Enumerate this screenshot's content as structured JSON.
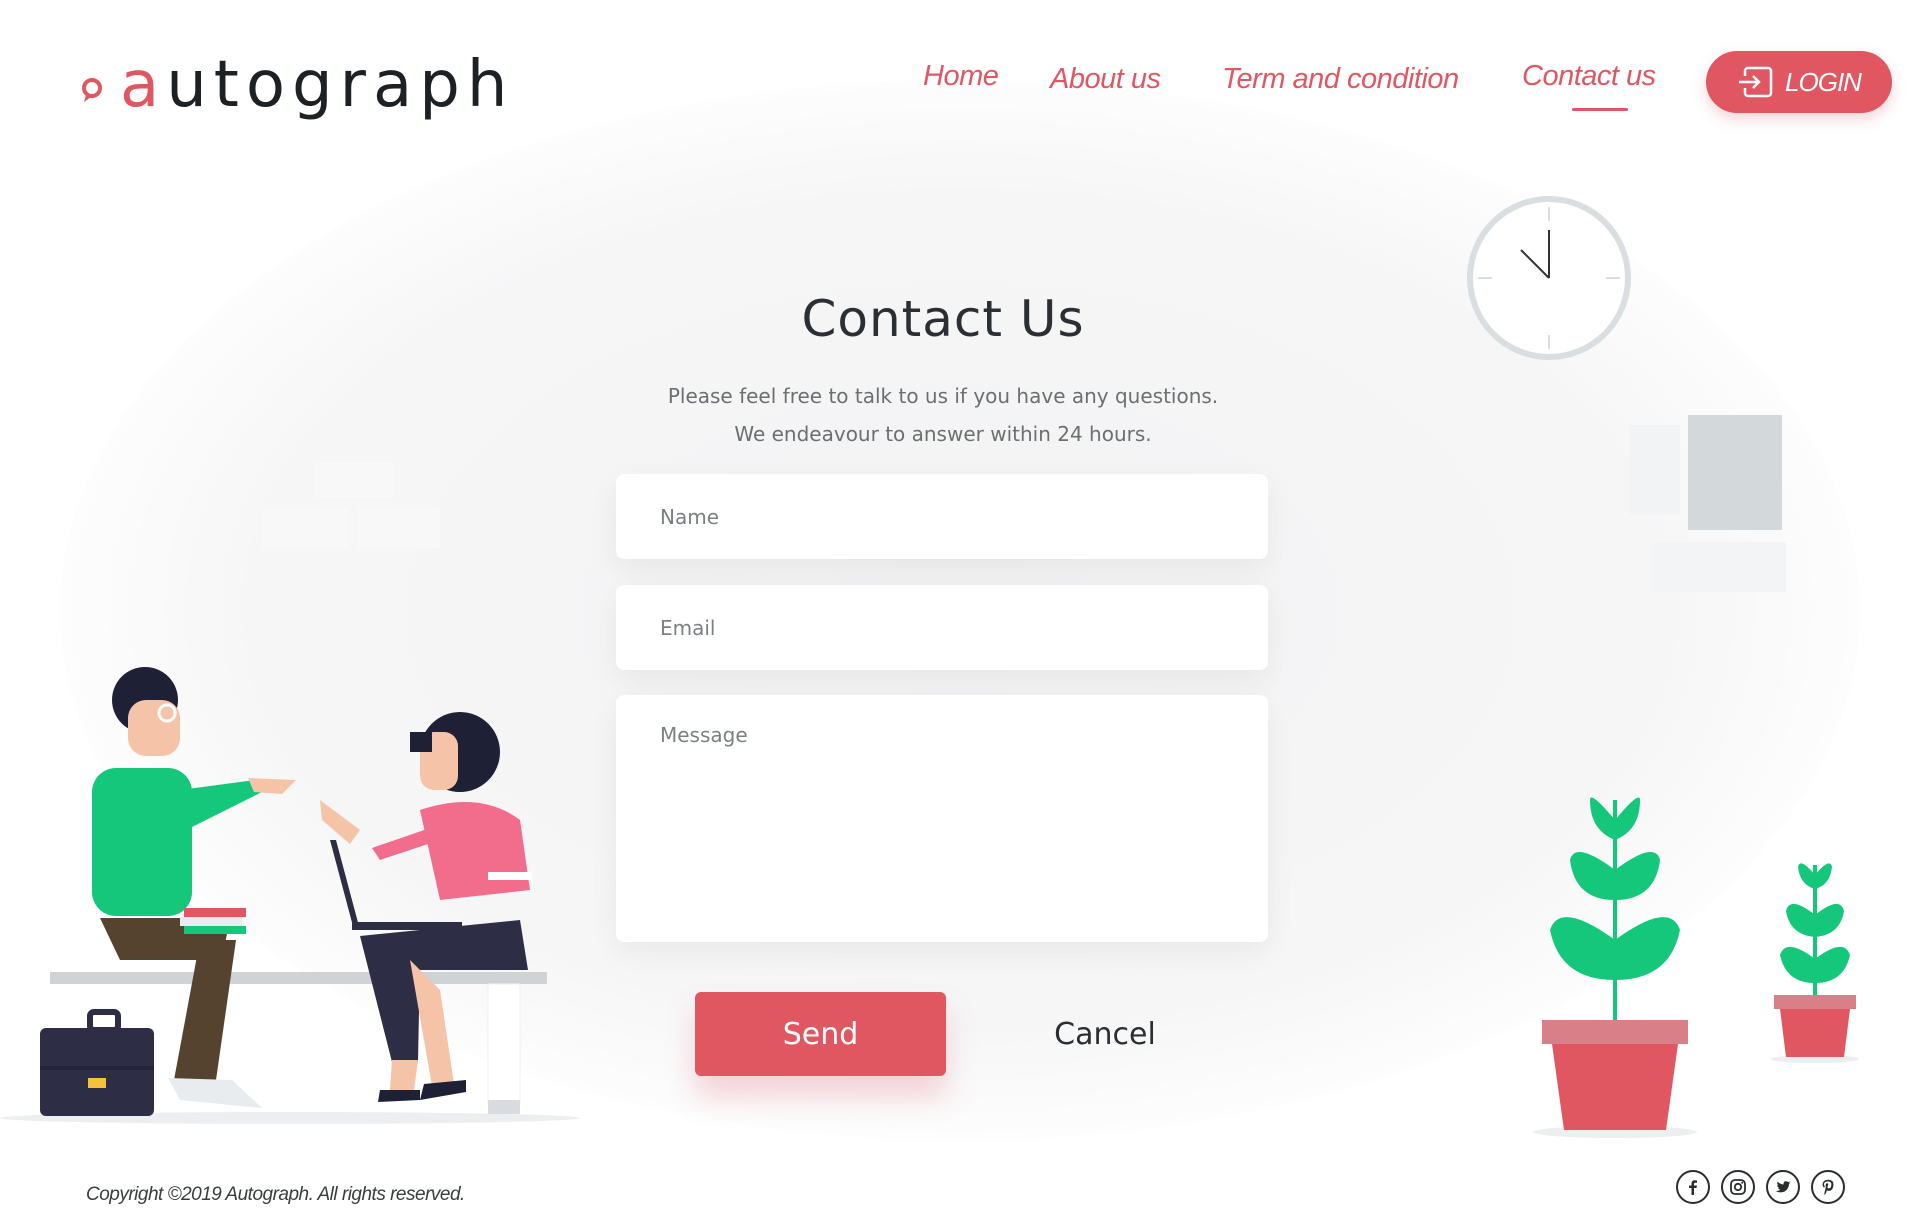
{
  "brand": {
    "name_accent": "a",
    "name_rest": "utograph",
    "accent_color": "#e05762"
  },
  "nav": {
    "items": [
      {
        "label": "Home"
      },
      {
        "label": "About us"
      },
      {
        "label": "Term and condition"
      },
      {
        "label": "Contact us",
        "active": true
      }
    ],
    "login_label": "LOGIN"
  },
  "main": {
    "title": "Contact Us",
    "subtitle_line1": "Please feel free to talk to us if you have any questions.",
    "subtitle_line2": "We endeavour to answer within 24 hours."
  },
  "form": {
    "name_placeholder": "Name",
    "email_placeholder": "Email",
    "message_placeholder": "Message",
    "send_label": "Send",
    "cancel_label": "Cancel"
  },
  "footer": {
    "copyright": "Copyright ©2019 Autograph. All rights reserved.",
    "socials": [
      "facebook-icon",
      "instagram-icon",
      "twitter-icon",
      "pinterest-icon"
    ]
  }
}
